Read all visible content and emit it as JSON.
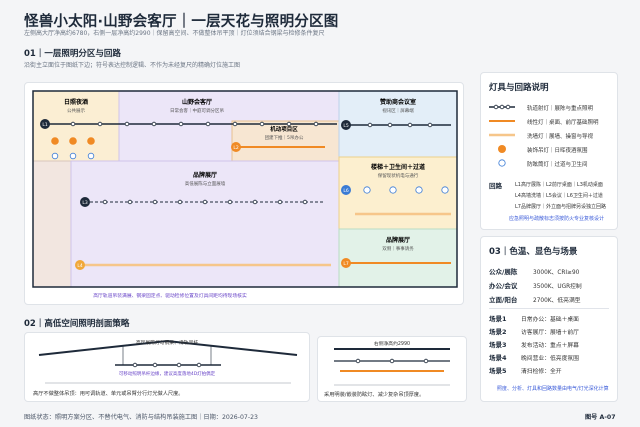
{
  "header": {
    "title": "怪兽小太阳·山野会客厅｜一层天花与照明分区图",
    "subtitle": "左侧高大厅净高约6780，右侧一层净高约2990｜保留高空间、不做整体吊平顶｜灯位须结合钢梁与检修条件复尺"
  },
  "section1": {
    "heading": "01｜一层照明分区与回路",
    "note": "沿街主立面位于图纸下边；符号表达控制逻辑、不作为未经复尺的精确灯位施工图"
  },
  "plan": {
    "zones": [
      {
        "name": "日照夜酒",
        "sub": "公共展示"
      },
      {
        "name": "山野会客厅",
        "sub": "日常会客｜中庭可调分区吊"
      },
      {
        "name": "机动项目区",
        "sub": "团建下推｜5吊办公"
      },
      {
        "name": "赞助商会议室",
        "sub": "视讯区｜屏幕端"
      },
      {
        "name": "品牌展厅",
        "sub": "高低展陈与立面展墙"
      },
      {
        "name": "楼梯＋卫生间＋过道",
        "sub": "保留现状机电与通行"
      },
      {
        "name": "品牌展厅",
        "sub": "双侧｜事事请务"
      }
    ],
    "circuits": [
      "L1",
      "L2",
      "L3",
      "L4",
      "L5",
      "L6",
      "L7"
    ],
    "note": "高厅轨道吊装满展、钢梁固定点、驱动检修位置及灯具间距均待现场核实"
  },
  "legend": {
    "title": "灯具与回路说明",
    "items": [
      {
        "label": "轨道射灯｜展陈与重点照明",
        "color": "#1e2a3a"
      },
      {
        "label": "线性灯｜桌面、前厅基础照明",
        "color": "#f08a24"
      },
      {
        "label": "洗墙灯｜展墙、操窗与导视",
        "color": "#f6c68a"
      },
      {
        "label": "装饰吊灯｜日晖夜酒氛围",
        "color": "#f08a24"
      },
      {
        "label": "防眩筒灯｜过道与卫生间",
        "color": "#3a7bd5"
      }
    ],
    "loops_label": "回路",
    "loops": [
      "L1高厅展陈｜L2前厅桌面｜L3机动桌面",
      "L4高墙洗墙｜L5会议｜L6卫生间＋过道",
      "L7品牌展厅｜外立面与招牌另设独立回路"
    ],
    "loops_note": "应急照明与疏散标志须按防火专业复核设计"
  },
  "cct": {
    "title": "03｜色温、显色与场景",
    "rows": [
      {
        "k": "公众/展陈",
        "v": "3000K、CRI≥90"
      },
      {
        "k": "办公/会议",
        "v": "3500K、UGR控制"
      },
      {
        "k": "立面/阳台",
        "v": "2700K、低亮满型"
      }
    ],
    "scenes": [
      {
        "k": "场景1",
        "v": "日常办公：基础＋桌面"
      },
      {
        "k": "场景2",
        "v": "访客展厅：展墙＋前厅"
      },
      {
        "k": "场景3",
        "v": "发布活动：重点＋屏幕"
      },
      {
        "k": "场景4",
        "v": "晚间营业：低亮度氛围"
      },
      {
        "k": "场景5",
        "v": "清扫检修：全开"
      }
    ],
    "note": "照度、分析、灯具和回路数量由电气/灯光深化计算"
  },
  "section2": {
    "heading": "02｜高低空间照明剖面策略",
    "left_label": "高厅展陈灯与钢梁、滑轨吊杆",
    "left_sub": "可移动照明吊杆边缘，建议高度落地4D灯拍偶定",
    "left_foot": "高厅不做整体吊顶：用可调轨道、单元或吊臂分行灯光做人尺度。",
    "right_label": "右侧净高约2990",
    "right_foot": "采用明装/嵌装防眩灯、减少复杂吊顶厚度。"
  },
  "footer": {
    "left": "图纸状态：照明方案分区、不替代电气、消防与结构吊装施工图｜日期：2026-07-23",
    "right": "图号 A-07"
  }
}
